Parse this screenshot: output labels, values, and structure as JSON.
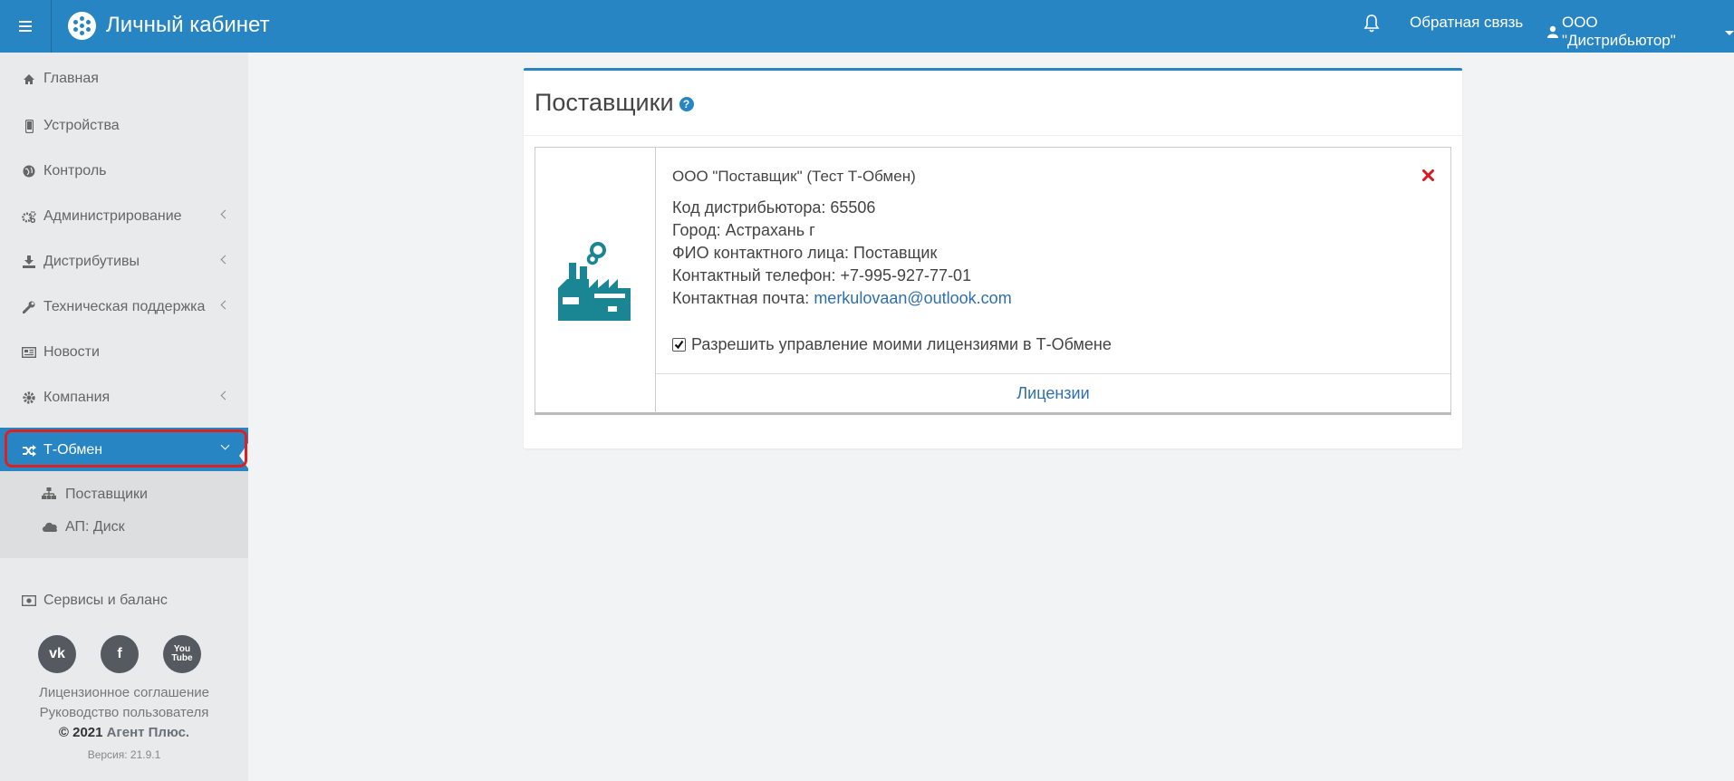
{
  "header": {
    "app_title": "Личный кабинет",
    "feedback": "Обратная связь",
    "account": "ООО \"Дистрибьютор\""
  },
  "sidebar": {
    "items": [
      {
        "label": "Главная",
        "icon": "home-icon"
      },
      {
        "label": "Устройства",
        "icon": "mobile-icon"
      },
      {
        "label": "Контроль",
        "icon": "globe-icon"
      },
      {
        "label": "Администрирование",
        "icon": "cogs-icon"
      },
      {
        "label": "Дистрибутивы",
        "icon": "download-icon"
      },
      {
        "label": "Техническая поддержка",
        "icon": "wrench-icon"
      },
      {
        "label": "Новости",
        "icon": "newspaper-icon"
      },
      {
        "label": "Компания",
        "icon": "gear-icon"
      },
      {
        "label": "Т-Обмен",
        "icon": "shuffle-icon"
      },
      {
        "label": "Сервисы и баланс",
        "icon": "money-icon"
      }
    ],
    "subitems": [
      {
        "label": "Поставщики",
        "icon": "sitemap-icon"
      },
      {
        "label": "АП: Диск",
        "icon": "cloud-icon"
      }
    ],
    "footer": {
      "license": "Лицензионное соглашение",
      "manual": "Руководство пользователя",
      "copyright": "© 2021",
      "company": "Агент Плюс.",
      "version": "Версия: 21.9.1"
    }
  },
  "main": {
    "title": "Поставщики",
    "supplier": {
      "name": "ООО \"Поставщик\" (Тест Т-Обмен)",
      "code": "Код дистрибьютора: 65506",
      "city": "Город: Астрахань г",
      "contact_person": "ФИО контактного лица: Поставщик",
      "phone": "Контактный телефон: +7-995-927-77-01",
      "email_label": "Контактная почта: ",
      "email": "merkulovaan@outlook.com",
      "permission": "Разрешить управление моими лицензиями в Т-Обмене",
      "permission_checked": true,
      "licenses_link": "Лицензии"
    }
  },
  "colors": {
    "brand": "#2785c3",
    "factory": "#1a8593",
    "delete": "#d9181f"
  }
}
